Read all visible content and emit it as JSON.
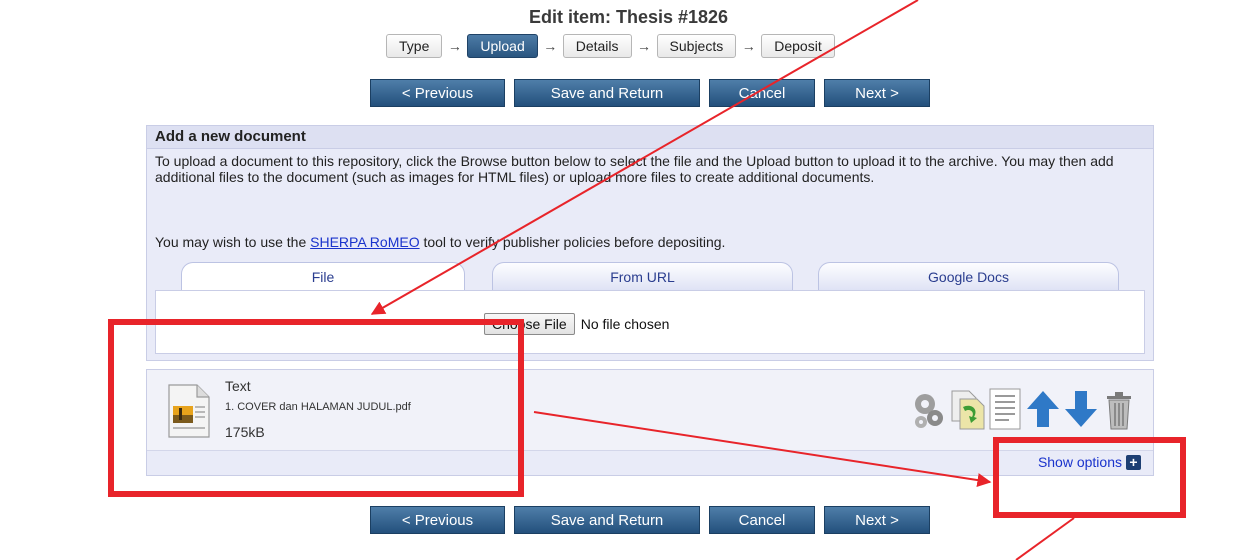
{
  "page": {
    "title": "Edit item: Thesis #1826"
  },
  "workflow": {
    "steps": [
      "Type",
      "Upload",
      "Details",
      "Subjects",
      "Deposit"
    ],
    "active_step": "Upload"
  },
  "nav": {
    "previous": "< Previous",
    "save_return": "Save and Return",
    "cancel": "Cancel",
    "next": "Next >"
  },
  "add_document": {
    "title": "Add a new document",
    "intro": "To upload a document to this repository, click the Browse button below to select the file and the Upload button to upload it to the archive. You may then add additional files to the document (such as images for HTML files) or upload more files to create additional documents.",
    "romeo_prefix": "You may wish to use the ",
    "romeo_link": "SHERPA RoMEO",
    "romeo_suffix": " tool to verify publisher policies before depositing.",
    "tabs": [
      "File",
      "From URL",
      "Google Docs"
    ],
    "active_tab": "File",
    "choose_file_label": "Choose File",
    "no_file_text": "No file chosen"
  },
  "document": {
    "type": "Text",
    "filename": "1. COVER dan HALAMAN JUDUL.pdf",
    "size": "175kB",
    "tools": [
      "gears-icon",
      "convert-icon",
      "details-icon",
      "move-up-icon",
      "move-down-icon",
      "trash-icon"
    ],
    "show_options": "Show options"
  },
  "colors": {
    "button": "#2d5b87",
    "panel": "#e9ebf8",
    "annotation": "#e8242a",
    "link": "#1a33cc"
  }
}
